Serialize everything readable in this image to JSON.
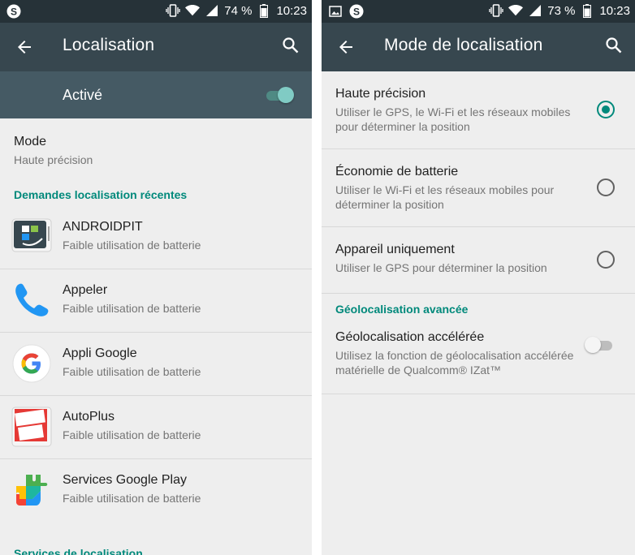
{
  "left": {
    "status": {
      "battery": "74 %",
      "time": "10:23"
    },
    "appbar": {
      "title": "Localisation"
    },
    "master_switch": {
      "label": "Activé",
      "on": true
    },
    "mode": {
      "title": "Mode",
      "value": "Haute précision"
    },
    "recent_header": "Demandes localisation récentes",
    "apps": [
      {
        "name": "ANDROIDPIT",
        "desc": "Faible utilisation de batterie",
        "icon": "androidpit-icon"
      },
      {
        "name": "Appeler",
        "desc": "Faible utilisation de batterie",
        "icon": "phone-icon"
      },
      {
        "name": "Appli Google",
        "desc": "Faible utilisation de batterie",
        "icon": "google-icon"
      },
      {
        "name": "AutoPlus",
        "desc": "Faible utilisation de batterie",
        "icon": "autoplus-icon"
      },
      {
        "name": "Services Google Play",
        "desc": "Faible utilisation de batterie",
        "icon": "play-services-icon"
      }
    ],
    "services_header": "Services de localisation",
    "autoplus_logo_text": "Auto Plus"
  },
  "right": {
    "status": {
      "battery": "73 %",
      "time": "10:23"
    },
    "appbar": {
      "title": "Mode de localisation"
    },
    "modes": [
      {
        "title": "Haute précision",
        "desc": "Utiliser le GPS, le Wi-Fi et les réseaux mobiles pour déterminer la position",
        "selected": true
      },
      {
        "title": "Économie de batterie",
        "desc": "Utiliser le Wi-Fi et les réseaux mobiles pour déterminer la position",
        "selected": false
      },
      {
        "title": "Appareil uniquement",
        "desc": "Utiliser le GPS pour déterminer la position",
        "selected": false
      }
    ],
    "advanced_header": "Géolocalisation avancée",
    "advanced": {
      "title": "Géolocalisation accélérée",
      "desc": "Utilisez la fonction de géolocalisation accélérée matérielle de Qualcomm® IZat™",
      "on": false
    }
  },
  "colors": {
    "accent": "#00897b",
    "toggle_on_thumb": "#80cbc4",
    "toggle_on_track": "#4f8a84",
    "toggle_off_thumb": "#f5f5f5",
    "toggle_off_track": "#bdbdbd",
    "statusbar": "#263238",
    "appbar": "#37474f",
    "master_bar": "#455a64"
  }
}
